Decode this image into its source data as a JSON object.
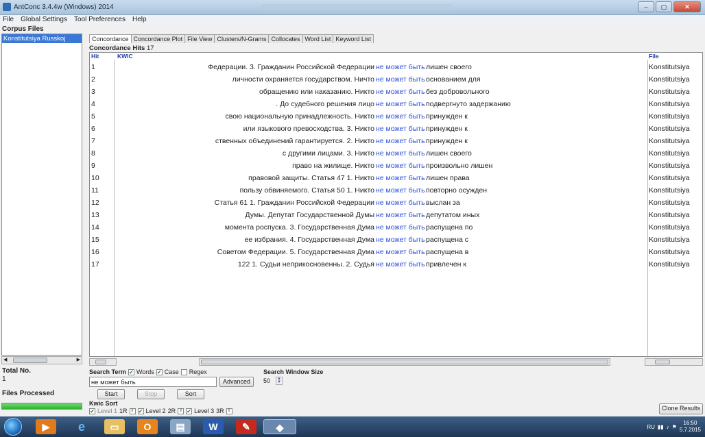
{
  "window": {
    "title": "AntConc 3.4.4w (Windows) 2014",
    "controls": {
      "minimize": "–",
      "maximize": "▢",
      "close": "✕"
    }
  },
  "menu": [
    "File",
    "Global Settings",
    "Tool Preferences",
    "Help"
  ],
  "left_panel": {
    "corpus_files_label": "Corpus Files",
    "files": [
      "Konstitutsiya Russkoj"
    ],
    "total_no_label": "Total No.",
    "total_no_value": "1",
    "files_processed_label": "Files Processed",
    "progress_fraction": 1.0
  },
  "tabs": [
    "Concordance",
    "Concordance Plot",
    "File View",
    "Clusters/N-Grams",
    "Collocates",
    "Word List",
    "Keyword List"
  ],
  "active_tab": "Concordance",
  "concordance": {
    "hits_label": "Concordance Hits",
    "hits_count": "17",
    "col_hit": "Hit",
    "col_kwic": "KWIC",
    "col_file": "File",
    "rows": [
      {
        "hit": "1",
        "left": "Федерации.   3. Гражданин Российской Федерации",
        "kw": "не может быть",
        "right": "лишен своего",
        "file": "Konstitutsiya"
      },
      {
        "hit": "2",
        "left": "личности охраняется государством. Ничто",
        "kw": "не может быть",
        "right": "основанием для",
        "file": "Konstitutsiya"
      },
      {
        "hit": "3",
        "left": "обращению или наказанию. Никто",
        "kw": "не может быть",
        "right": "без добровольного",
        "file": "Konstitutsiya"
      },
      {
        "hit": "4",
        "left": ". До судебного решения лицо",
        "kw": "не может быть",
        "right": "подвергнуто задержанию",
        "file": "Konstitutsiya"
      },
      {
        "hit": "5",
        "left": "свою национальную принадлежность. Никто",
        "kw": "не может быть",
        "right": "принужден к",
        "file": "Konstitutsiya"
      },
      {
        "hit": "6",
        "left": "или языкового превосходства.    3. Никто",
        "kw": "не может быть",
        "right": "принужден к",
        "file": "Konstitutsiya"
      },
      {
        "hit": "7",
        "left": "ственных объединений гарантируется.    2. Никто",
        "kw": "не может быть",
        "right": "принужден к",
        "file": "Konstitutsiya"
      },
      {
        "hit": "8",
        "left": "с другими лицами.    3. Никто",
        "kw": "не может быть",
        "right": "лишен своего",
        "file": "Konstitutsiya"
      },
      {
        "hit": "9",
        "left": "право на жилище. Никто",
        "kw": "не может быть",
        "right": "произвольно лишен",
        "file": "Konstitutsiya"
      },
      {
        "hit": "10",
        "left": "правовой защиты.  Статья 47    1. Никто",
        "kw": "не может быть",
        "right": "лишен права",
        "file": "Konstitutsiya"
      },
      {
        "hit": "11",
        "left": "пользу обвиняемого.  Статья 50    1. Никто",
        "kw": "не может быть",
        "right": "повторно осужден",
        "file": "Konstitutsiya"
      },
      {
        "hit": "12",
        "left": "Статья 61    1. Гражданин Российской Федерации",
        "kw": "не может быть",
        "right": "выслан за",
        "file": "Konstitutsiya"
      },
      {
        "hit": "13",
        "left": "Думы. Депутат Государственной Думы",
        "kw": "не может быть",
        "right": "депутатом иных",
        "file": "Konstitutsiya"
      },
      {
        "hit": "14",
        "left": "момента роспуска.    3. Государственная Дума",
        "kw": "не может быть",
        "right": "распущена по",
        "file": "Konstitutsiya"
      },
      {
        "hit": "15",
        "left": "ее избрания.    4. Государственная Дума",
        "kw": "не может быть",
        "right": "распущена с",
        "file": "Konstitutsiya"
      },
      {
        "hit": "16",
        "left": "Советом Федерации.    5. Государственная Дума",
        "kw": "не может быть",
        "right": "распущена в",
        "file": "Konstitutsiya"
      },
      {
        "hit": "17",
        "left": "122    1. Судьи неприкосновенны.    2. Судья",
        "kw": "не может быть",
        "right": "привлечен к",
        "file": "Konstitutsiya"
      }
    ]
  },
  "search": {
    "search_term_label": "Search Term",
    "words_label": "Words",
    "case_label": "Case",
    "regex_label": "Regex",
    "words_checked": true,
    "case_checked": true,
    "regex_checked": false,
    "search_window_size_label": "Search Window Size",
    "search_window_size": "50",
    "query": "не может быть",
    "advanced_label": "Advanced",
    "start_label": "Start",
    "stop_label": "Stop",
    "sort_label": "Sort",
    "kwic_sort_label": "Kwic Sort",
    "level1_label": "Level 1",
    "level1_value": "1R",
    "level2_label": "Level 2",
    "level2_value": "2R",
    "level3_label": "Level 3",
    "level3_value": "3R",
    "clone_results_label": "Clone Results"
  },
  "taskbar": {
    "tray_lang": "RU",
    "clock_time": "16:50",
    "clock_date": "5.7.2015"
  },
  "colors": {
    "keyword": "#2b4fd8",
    "selected_file_bg": "#3a78d8",
    "progress_fill": "#2fb22f"
  }
}
